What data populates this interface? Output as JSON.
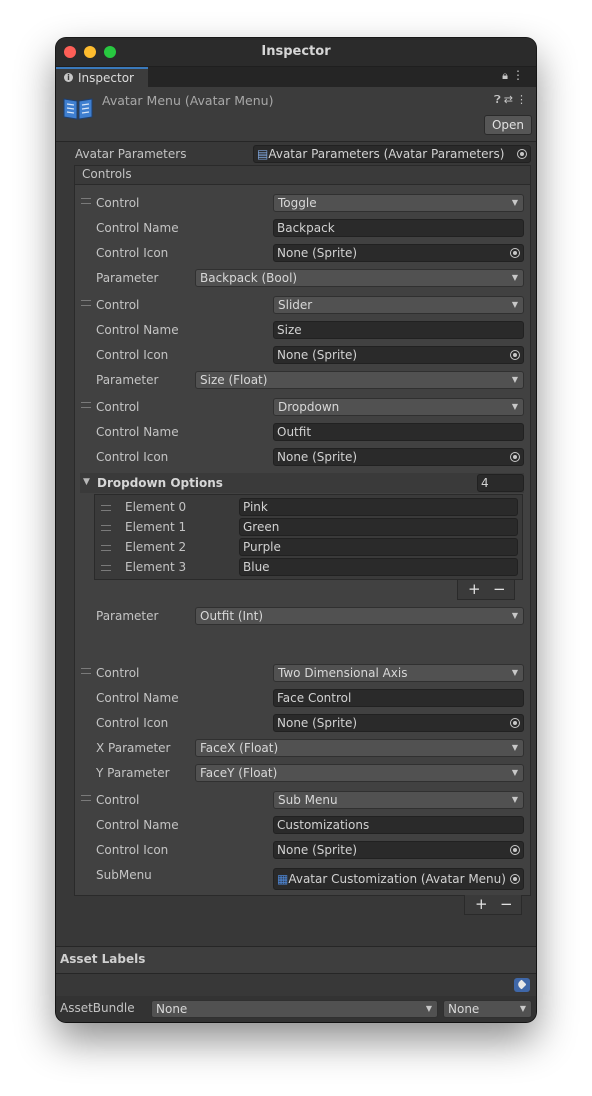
{
  "window": {
    "title": "Inspector"
  },
  "tab": {
    "label": "Inspector"
  },
  "header": {
    "asset_title": "Avatar Menu (Avatar Menu)",
    "open_label": "Open"
  },
  "avatar_parameters": {
    "label": "Avatar Parameters",
    "value": "Avatar Parameters (Avatar Parameters)"
  },
  "controls": {
    "header": "Controls",
    "items": [
      {
        "control_label": "Control",
        "type": "Toggle",
        "name_label": "Control Name",
        "name": "Backpack",
        "icon_label": "Control Icon",
        "icon": "None (Sprite)",
        "param_label": "Parameter",
        "param": "Backpack (Bool)"
      },
      {
        "control_label": "Control",
        "type": "Slider",
        "name_label": "Control Name",
        "name": "Size",
        "icon_label": "Control Icon",
        "icon": "None (Sprite)",
        "param_label": "Parameter",
        "param": "Size (Float)"
      },
      {
        "control_label": "Control",
        "type": "Dropdown",
        "name_label": "Control Name",
        "name": "Outfit",
        "icon_label": "Control Icon",
        "icon": "None (Sprite)",
        "param_label": "Parameter",
        "param": "Outfit (Int)",
        "options_label": "Dropdown Options",
        "options_count": "4",
        "elements": [
          {
            "label": "Element 0",
            "value": "Pink"
          },
          {
            "label": "Element 1",
            "value": "Green"
          },
          {
            "label": "Element 2",
            "value": "Purple"
          },
          {
            "label": "Element 3",
            "value": "Blue"
          }
        ]
      },
      {
        "control_label": "Control",
        "type": "Two Dimensional Axis",
        "name_label": "Control Name",
        "name": "Face Control",
        "icon_label": "Control Icon",
        "icon": "None (Sprite)",
        "xparam_label": "X Parameter",
        "xparam": "FaceX (Float)",
        "yparam_label": "Y Parameter",
        "yparam": "FaceY (Float)"
      },
      {
        "control_label": "Control",
        "type": "Sub Menu",
        "name_label": "Control Name",
        "name": "Customizations",
        "icon_label": "Control Icon",
        "icon": "None (Sprite)",
        "submenu_label": "SubMenu",
        "submenu": "Avatar Customization (Avatar Menu)"
      }
    ],
    "plus": "+",
    "minus": "−"
  },
  "asset_labels": {
    "title": "Asset Labels"
  },
  "asset_bundle": {
    "label": "AssetBundle",
    "name": "None",
    "variant": "None"
  },
  "colors": {
    "accent": "#3a79bb",
    "window_bg": "#383838"
  }
}
